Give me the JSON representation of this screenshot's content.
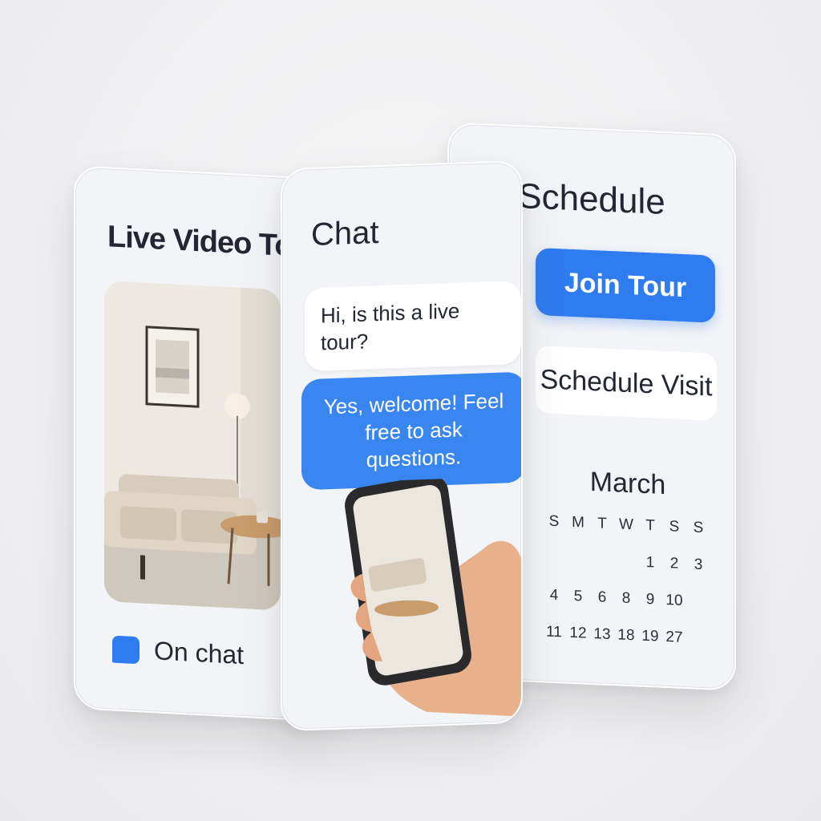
{
  "video_card": {
    "title": "Live Video Tour",
    "status_label": "On chat"
  },
  "chat_card": {
    "title": "Chat",
    "messages": [
      {
        "from": "visitor",
        "text": "Hi, is this a live tour?"
      },
      {
        "from": "agent",
        "text": "Yes, welcome! Feel free to ask questions."
      }
    ]
  },
  "schedule_card": {
    "title": "Schedule",
    "join_label": "Join Tour",
    "visit_label": "Schedule Visit",
    "month": "March",
    "weekdays": [
      "S",
      "M",
      "T",
      "W",
      "T",
      "S",
      "S"
    ],
    "days": [
      "",
      "",
      "",
      "",
      "1",
      "2",
      "3",
      "4",
      "5",
      "6",
      "8",
      "9",
      "10",
      "",
      "11",
      "12",
      "13",
      "18",
      "19",
      "27",
      ""
    ]
  },
  "colors": {
    "accent": "#2f7bf0"
  }
}
